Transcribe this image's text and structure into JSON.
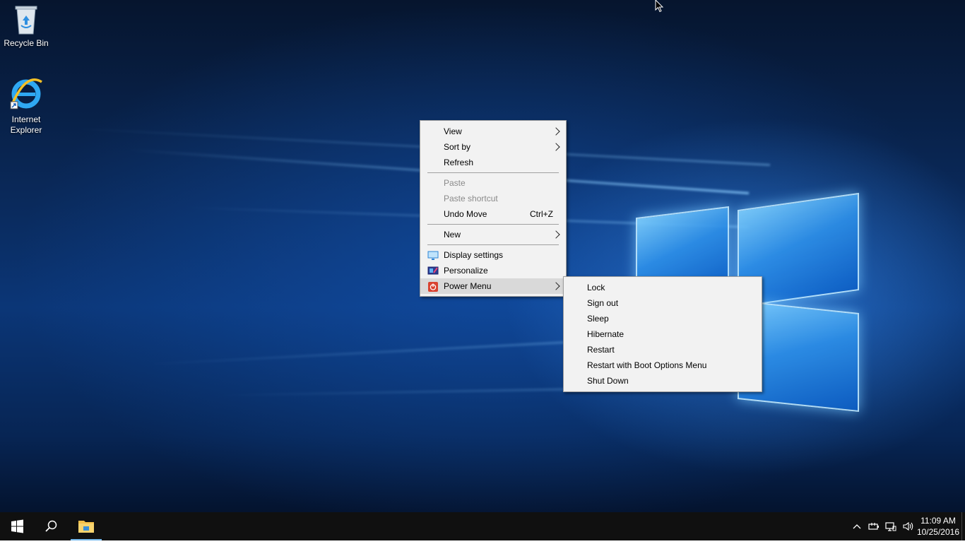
{
  "desktop": {
    "icons": [
      {
        "label": "Recycle Bin",
        "icon": "recycle-bin-icon"
      },
      {
        "label": "Internet Explorer",
        "icon": "internet-explorer-icon"
      }
    ]
  },
  "context_menu": {
    "items": [
      {
        "label": "View",
        "submenu": true
      },
      {
        "label": "Sort by",
        "submenu": true
      },
      {
        "label": "Refresh"
      },
      {
        "label": "Paste",
        "disabled": true
      },
      {
        "label": "Paste shortcut",
        "disabled": true
      },
      {
        "label": "Undo Move",
        "shortcut": "Ctrl+Z"
      },
      {
        "label": "New",
        "submenu": true
      },
      {
        "label": "Display settings",
        "icon": "display-icon"
      },
      {
        "label": "Personalize",
        "icon": "personalize-icon"
      },
      {
        "label": "Power Menu",
        "icon": "power-icon",
        "submenu": true,
        "active": true
      }
    ]
  },
  "power_submenu": {
    "items": [
      {
        "label": "Lock"
      },
      {
        "label": "Sign out"
      },
      {
        "label": "Sleep"
      },
      {
        "label": "Hibernate"
      },
      {
        "label": "Restart"
      },
      {
        "label": "Restart with Boot Options Menu"
      },
      {
        "label": "Shut Down"
      }
    ]
  },
  "taskbar": {
    "buttons": [
      "start-icon",
      "search-icon",
      "file-explorer-icon"
    ],
    "tray_icons": [
      "chevron-up-icon",
      "power-plug-icon",
      "network-icon",
      "volume-icon"
    ],
    "clock": {
      "time": "11:09 AM",
      "date": "10/25/2016"
    }
  },
  "colors": {
    "menu_bg": "#f2f2f2",
    "menu_active": "#d9d9d9",
    "taskbar_bg": "#101010",
    "desktop_blue": "#0b3677"
  }
}
